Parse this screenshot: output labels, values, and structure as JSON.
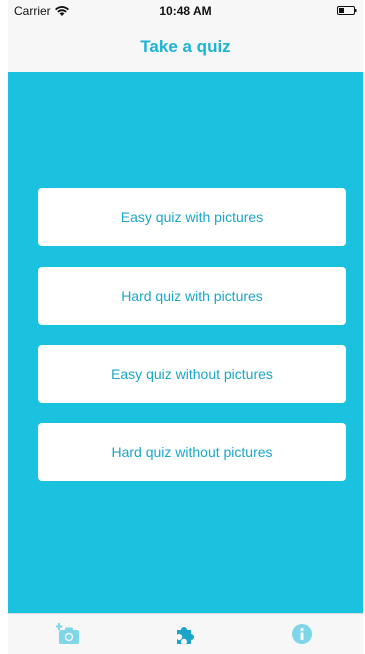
{
  "status_bar": {
    "carrier": "Carrier",
    "time": "10:48 AM",
    "wifi_icon": "wifi-icon",
    "battery_icon": "battery-icon"
  },
  "nav": {
    "title": "Take a quiz"
  },
  "quiz_buttons": [
    {
      "label": "Easy quiz with pictures"
    },
    {
      "label": "Hard quiz with pictures"
    },
    {
      "label": "Easy quiz without pictures"
    },
    {
      "label": "Hard quiz without pictures"
    }
  ],
  "tab_bar": {
    "tabs": [
      {
        "icon": "add-photo-icon"
      },
      {
        "icon": "puzzle-icon"
      },
      {
        "icon": "info-icon"
      }
    ]
  },
  "colors": {
    "accent": "#1ac2df",
    "title": "#1cb4d6",
    "button_text": "#1aa6c8",
    "tab_icon": "#7fd6e8",
    "tab_icon_active": "#1aa6c8"
  }
}
